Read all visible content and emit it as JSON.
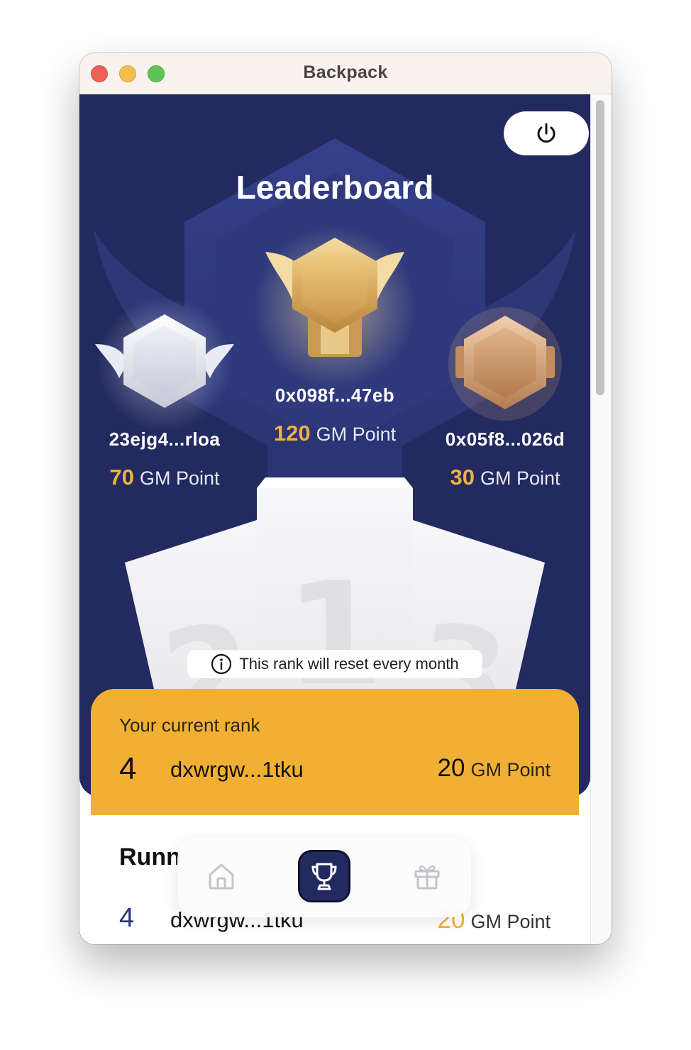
{
  "window": {
    "title": "Backpack"
  },
  "header": {
    "title": "Leaderboard",
    "power_icon": "power-icon"
  },
  "podium": {
    "first": {
      "address": "0x098f...47eb",
      "points": "120",
      "unit": "GM Point",
      "position": "1"
    },
    "second": {
      "address": "23ejg4...rloa",
      "points": "70",
      "unit": "GM Point",
      "position": "2"
    },
    "third": {
      "address": "0x05f8...026d",
      "points": "30",
      "unit": "GM Point",
      "position": "3"
    }
  },
  "notice": {
    "text": "This rank will reset every month",
    "icon": "info-icon"
  },
  "current_rank": {
    "label": "Your current rank",
    "rank": "4",
    "address": "dxwrgw...1tku",
    "points": "20",
    "unit": "GM Point"
  },
  "running": {
    "title": "Runn",
    "rows": [
      {
        "rank": "4",
        "address": "dxwrgw...1tku",
        "points": "20",
        "unit": "GM Point"
      }
    ]
  },
  "tabs": [
    {
      "icon": "home-icon",
      "active": false
    },
    {
      "icon": "trophy-icon",
      "active": true
    },
    {
      "icon": "gift-icon",
      "active": false
    }
  ],
  "colors": {
    "hero_bg": "#232a5f",
    "accent_gold": "#f1b034",
    "card_bg": "#ffffff"
  }
}
